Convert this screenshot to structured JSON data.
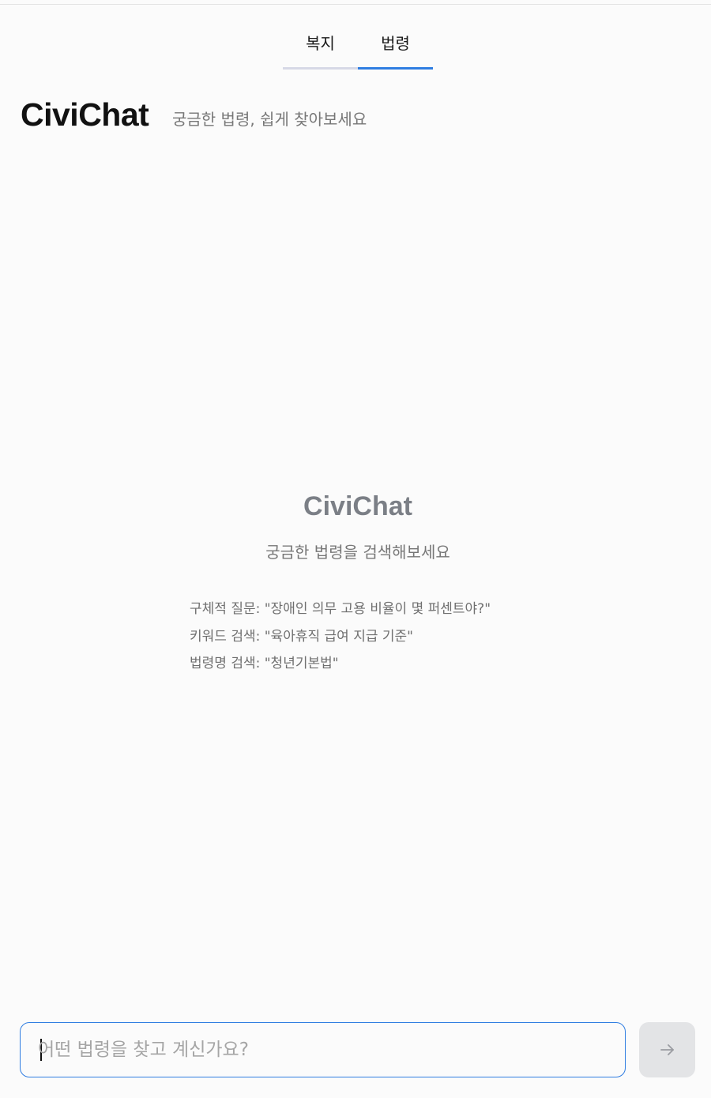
{
  "tabs": [
    {
      "label": "복지",
      "active": false
    },
    {
      "label": "법령",
      "active": true
    }
  ],
  "header": {
    "brand": "CiviChat",
    "tagline": "궁금한 법령, 쉽게 찾아보세요"
  },
  "empty_state": {
    "title": "CiviChat",
    "subtitle": "궁금한 법령을 검색해보세요",
    "examples": [
      "구체적 질문: \"장애인 의무 고용 비율이 몇 퍼센트야?\"",
      "키워드 검색: \"육아휴직 급여 지급 기준\"",
      "법령명 검색: \"청년기본법\""
    ]
  },
  "composer": {
    "placeholder": "어떤 법령을 찾고 계신가요?",
    "value": "",
    "send_icon": "arrow-right-icon"
  },
  "colors": {
    "accent": "#2f7de1",
    "background": "#fbfbfb",
    "send_button_disabled": "#e3e4e6"
  }
}
